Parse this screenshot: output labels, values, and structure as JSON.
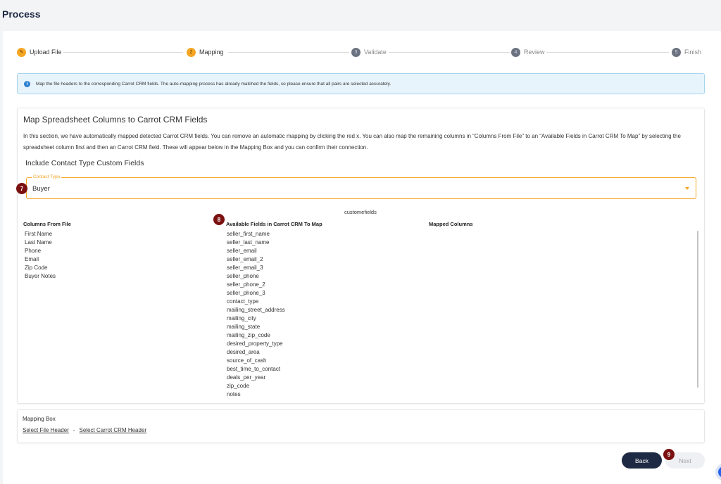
{
  "header": {
    "title": "Process"
  },
  "stepper": {
    "steps": [
      {
        "label": "Upload File",
        "marker": "✎",
        "state": "done"
      },
      {
        "label": "Mapping",
        "marker": "2",
        "state": "active"
      },
      {
        "label": "Validate",
        "marker": "3",
        "state": "inactive"
      },
      {
        "label": "Review",
        "marker": "4",
        "state": "inactive"
      },
      {
        "label": "Finish",
        "marker": "5",
        "state": "inactive"
      }
    ]
  },
  "info_banner": {
    "icon": "info-icon",
    "text": "Map the file headers to the corresponding Carrot CRM fields. The auto-mapping process has already matched the fields, so please ensure that all pairs are selected accurately."
  },
  "map_section": {
    "title": "Map Spreadsheet Columns to Carrot CRM Fields",
    "description": "In this section, we have automatically mapped detected Carrot CRM fields. You can remove an automatic mapping by clicking the red x. You can also map the remaining columns in “Columns From File” to an “Available Fields in Carrot CRM To Map” by selecting the spreadsheet column first and then an Carrot CRM field. These will appear below in the Mapping Box and you can confirm their connection.",
    "include_title": "Include Contact Type Custom Fields",
    "contact_type": {
      "label": "Contact Type",
      "value": "Buyer"
    },
    "custom_fields_label": "customefields",
    "columns_from_file": {
      "header": "Columns From File",
      "items": [
        "First Name",
        "Last Name",
        "Phone",
        "Email",
        "Zip Code",
        "Buyer Notes"
      ]
    },
    "available_fields": {
      "header": "Available Fields in Carrot CRM To Map",
      "items": [
        "seller_first_name",
        "seller_last_name",
        "seller_email",
        "seller_email_2",
        "seller_email_3",
        "seller_phone",
        "seller_phone_2",
        "seller_phone_3",
        "contact_type",
        "mailing_street_address",
        "mailing_city",
        "mailing_state",
        "mailing_zip_code",
        "desired_property_type",
        "desired_area",
        "source_of_cash",
        "best_time_to_contact",
        "deals_per_year",
        "zip_code",
        "notes"
      ]
    },
    "mapped_columns": {
      "header": "Mapped Columns"
    }
  },
  "badges": {
    "b7": "7",
    "b8": "8",
    "b9": "9"
  },
  "mapping_box": {
    "title": "Mapping Box",
    "file_header_link": "Select File Header",
    "separator": "-",
    "crm_header_link": "Select Carrot CRM Header"
  },
  "footer": {
    "back_label": "Back",
    "next_label": "Next"
  },
  "colors": {
    "accent": "#f5a623",
    "primary": "#1e2a44",
    "badge": "#7a1010",
    "info_bg": "#e8f4fb"
  }
}
